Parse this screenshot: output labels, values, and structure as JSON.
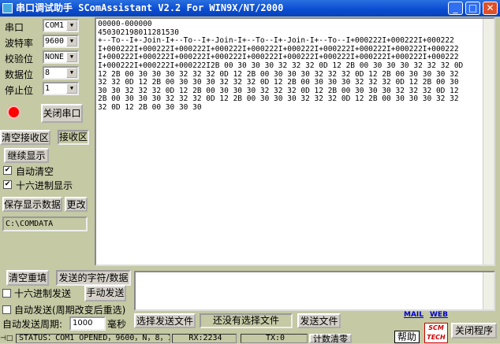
{
  "window": {
    "title": "串口调试助手  SComAssistant V2.2 For WIN9X/NT/2000"
  },
  "settings": [
    {
      "label": "串口",
      "value": "COM1"
    },
    {
      "label": "波特率",
      "value": "9600"
    },
    {
      "label": "校验位",
      "value": "NONE"
    },
    {
      "label": "数据位",
      "value": "8"
    },
    {
      "label": "停止位",
      "value": "1"
    }
  ],
  "port_led_color": "#ff0000",
  "close_port": "关闭串口",
  "clear_recv": "清空接收区",
  "recv_area_label": "接收区",
  "continue_display": "继续显示",
  "auto_clear": {
    "label": "自动清空",
    "checked": true
  },
  "hex_display": {
    "label": "十六进制显示",
    "checked": true
  },
  "save_data": "保存显示数据",
  "change": "更改",
  "path": "C:\\COMDATA",
  "recv_lines": [
    "00000-000000",
    "450302198011281530",
    "+--To--I+-Join-I+--To--I+-Join-I+--To--I+-Join-I+--To--I+000222I+000222I+000222",
    "I+000222I+000222I+000222I+000222I+000222I+000222I+000222I+000222I+000222I+000222",
    "I+000222I+000222I+000222I+000222I+000222I+000222I+000222I+000222I+000222I+000222",
    "I+000222I+000222I+000222I2B 00 30 30 30 32 32 32 0D 12 2B 00 30 30 30 32 32 32 0D",
    "12 2B 00 30 30 30 32 32 32 0D 12 2B 00 30 30 30 32 32 32 0D 12 2B 00 30 30 30 32",
    "32 32 0D 12 2B 00 30 30 30 32 32 32 0D 12 2B 00 30 30 30 32 32 32 0D 12 2B 00 30",
    "30 30 32 32 32 0D 12 2B 00 30 30 30 32 32 32 0D 12 2B 00 30 30 30 32 32 32 0D 12",
    "2B 00 30 30 30 32 32 32 0D 12 2B 00 30 30 30 32 32 32 0D 12 2B 00 30 30 30 32 32",
    "32 0D 12 2B 00 30 30 30"
  ],
  "clear_refill": "清空重填",
  "send_label": "发送的字符/数据",
  "send_text": "",
  "hex_send": {
    "label": "十六进制发送",
    "checked": false
  },
  "manual_send": "手动发送",
  "auto_send": {
    "label": "自动发送(周期改变后重选)",
    "checked": false
  },
  "auto_period_label": "自动发送周期:",
  "auto_period_value": "1000",
  "ms": "毫秒",
  "choose_file": "选择发送文件",
  "file_status": "还没有选择文件",
  "send_file": "发送文件",
  "mail": "MAIL",
  "web": "WEB",
  "help": "帮助",
  "exit": "关闭程序",
  "status": {
    "text": "STATUS：COM1 OPENED，9600，N，8，1",
    "rx": "RX:2234",
    "tx": "TX:0",
    "reset": "计数清零"
  }
}
